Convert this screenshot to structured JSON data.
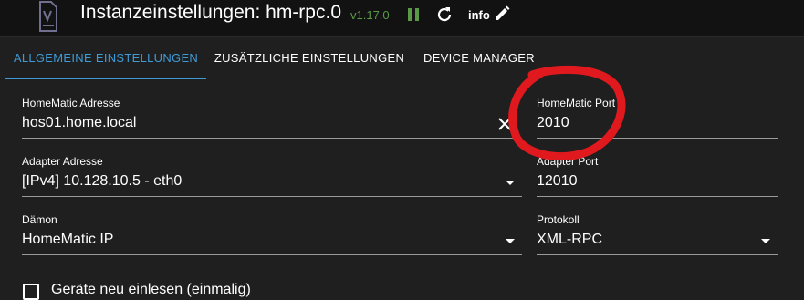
{
  "header": {
    "title": "Instanzeinstellungen: hm-rpc.0",
    "version": "v1.17.0",
    "info_label": "info",
    "version_color": "#5a9a47",
    "icons": [
      "adapter-logo-icon",
      "pause-icon",
      "reload-icon",
      "edit-icon"
    ]
  },
  "tabs": [
    {
      "label": "ALLGEMEINE EINSTELLUNGEN",
      "active": true
    },
    {
      "label": "ZUSÄTZLICHE EINSTELLUNGEN",
      "active": false
    },
    {
      "label": "DEVICE MANAGER",
      "active": false
    }
  ],
  "accent_color": "#3f9bd6",
  "form": {
    "homematic_address": {
      "label": "HomeMatic Adresse",
      "value": "hos01.home.local"
    },
    "homematic_port": {
      "label": "HomeMatic Port",
      "value": "2010"
    },
    "adapter_address": {
      "label": "Adapter Adresse",
      "value": "[IPv4] 10.128.10.5 - eth0"
    },
    "adapter_port": {
      "label": "Adapter Port",
      "value": "12010"
    },
    "daemon": {
      "label": "Dämon",
      "value": "HomeMatic IP"
    },
    "protocol": {
      "label": "Protokoll",
      "value": "XML-RPC"
    },
    "reload_devices": {
      "label": "Geräte neu einlesen (einmalig)",
      "checked": false
    }
  },
  "annotation_color": "#e0191e"
}
